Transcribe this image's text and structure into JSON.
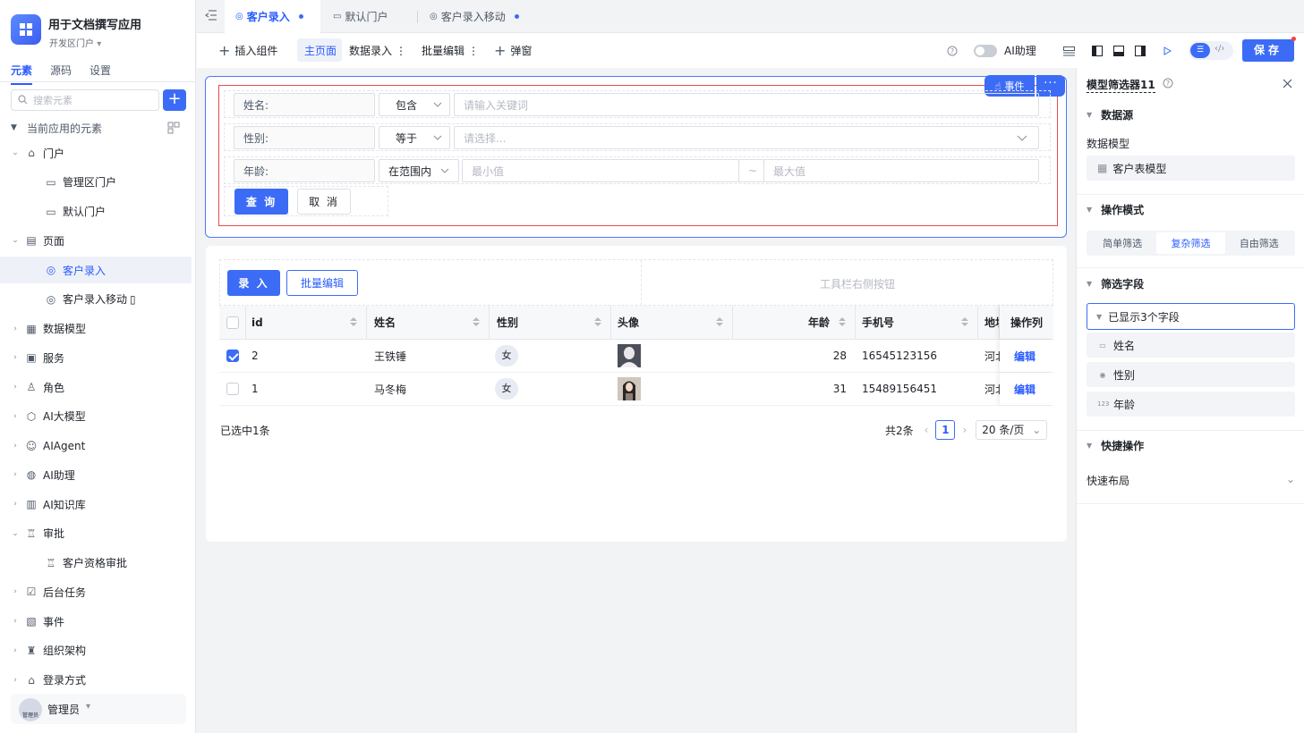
{
  "app": {
    "name": "用于文档撰写应用",
    "portal": "开发区门户",
    "left_tabs": [
      "元素",
      "源码",
      "设置"
    ],
    "search_placeholder": "搜索元素",
    "add_label": "+",
    "tree_header": "当前应用的元素",
    "tree": [
      {
        "label": "门户",
        "icon": "home-icon",
        "expanded": true
      },
      {
        "label": "管理区门户",
        "icon": "monitor-icon"
      },
      {
        "label": "默认门户",
        "icon": "monitor-icon"
      },
      {
        "label": "页面",
        "icon": "page-icon",
        "expanded": true
      },
      {
        "label": "客户录入",
        "icon": "globe-page-icon",
        "selected": true
      },
      {
        "label": "客户录入移动",
        "icon": "globe-page-icon"
      },
      {
        "label": "数据模型",
        "icon": "table-icon"
      },
      {
        "label": "服务",
        "icon": "service-icon"
      },
      {
        "label": "角色",
        "icon": "role-icon"
      },
      {
        "label": "AI大模型",
        "icon": "ai-model-icon"
      },
      {
        "label": "AIAgent",
        "icon": "robot-icon"
      },
      {
        "label": "AI助理",
        "icon": "ai-assistant-icon"
      },
      {
        "label": "AI知识库",
        "icon": "book-icon"
      },
      {
        "label": "审批",
        "icon": "approval-icon",
        "expanded": true
      },
      {
        "label": "客户资格审批",
        "icon": "approval-icon"
      },
      {
        "label": "后台任务",
        "icon": "task-icon"
      },
      {
        "label": "事件",
        "icon": "event-icon"
      },
      {
        "label": "组织架构",
        "icon": "org-icon"
      },
      {
        "label": "登录方式",
        "icon": "login-icon"
      }
    ],
    "admin": {
      "avatar_text": "管理员",
      "name": "管理员"
    }
  },
  "tabs": [
    {
      "label": "客户录入",
      "active": true,
      "dot": true
    },
    {
      "label": "默认门户",
      "active": false,
      "dot": false
    },
    {
      "label": "客户录入移动",
      "active": false,
      "dot": true
    }
  ],
  "toolbar": {
    "insert": "插入组件",
    "main_page": "主页面",
    "data_entry": "数据录入",
    "batch_edit": "批量编辑",
    "popup": "弹窗",
    "ai_assistant": "AI助理",
    "save": "保存"
  },
  "filter": {
    "event": "事件",
    "more": "···",
    "rows": [
      {
        "field": "姓名:",
        "op": "包含",
        "placeholder": "请输入关键词"
      },
      {
        "field": "性别:",
        "op": "等于",
        "placeholder": "请选择..."
      },
      {
        "field": "年龄:",
        "op": "在范围内",
        "min_placeholder": "最小值",
        "sep": "~",
        "max_placeholder": "最大值"
      }
    ],
    "query": "查 询",
    "cancel": "取 消"
  },
  "table": {
    "entry_btn": "录 入",
    "batch_btn": "批量编辑",
    "toolbar_right": "工具栏右侧按钮",
    "columns": [
      "id",
      "姓名",
      "性别",
      "头像",
      "年龄",
      "手机号",
      "地址",
      "操作列"
    ],
    "rows": [
      {
        "checked": true,
        "id": "2",
        "name": "王铁锤",
        "gender": "女",
        "age": "28",
        "phone": "16545123156",
        "address": "河北",
        "action": "编辑"
      },
      {
        "checked": false,
        "id": "1",
        "name": "马冬梅",
        "gender": "女",
        "age": "31",
        "phone": "15489156451",
        "address": "河北",
        "action": "编辑"
      }
    ],
    "selected_text": "已选中1条",
    "total": "共2条",
    "page": "1",
    "page_size": "20 条/页"
  },
  "panel": {
    "title": "模型筛选器11",
    "datasource": "数据源",
    "model_label": "数据模型",
    "model_value": "客户表模型",
    "mode_head": "操作模式",
    "modes": [
      "简单筛选",
      "复杂筛选",
      "自由筛选"
    ],
    "active_mode": 1,
    "fields_head": "筛选字段",
    "fields_dropdown": "已显示3个字段",
    "fields": [
      {
        "icon": "text-field-icon",
        "label": "姓名"
      },
      {
        "icon": "radio-field-icon",
        "label": "性别"
      },
      {
        "icon": "number-field-icon",
        "label": "年龄"
      }
    ],
    "quick_head": "快捷操作",
    "quick_layout": "快速布局"
  },
  "colors": {
    "accent": "#3c6cf6",
    "selection_border": "#e34d4d"
  }
}
